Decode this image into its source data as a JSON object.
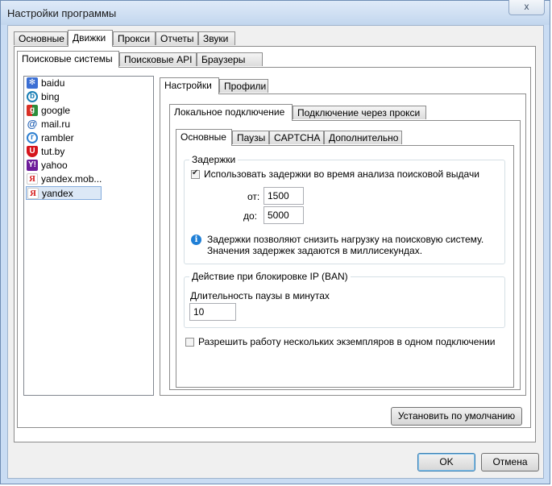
{
  "window": {
    "title": "Настройки программы",
    "close_label": "x"
  },
  "main_tabs": [
    "Основные",
    "Движки",
    "Прокси",
    "Отчеты",
    "Звуки"
  ],
  "engine_tabs": [
    "Поисковые системы",
    "Поисковые API",
    "Браузеры"
  ],
  "engines": [
    {
      "label": "baidu",
      "icon": "baidu-icon"
    },
    {
      "label": "bing",
      "icon": "bing-icon"
    },
    {
      "label": "google",
      "icon": "google-icon"
    },
    {
      "label": "mail.ru",
      "icon": "mailru-icon"
    },
    {
      "label": "rambler",
      "icon": "rambler-icon"
    },
    {
      "label": "tut.by",
      "icon": "tutby-icon"
    },
    {
      "label": "yahoo",
      "icon": "yahoo-icon"
    },
    {
      "label": "yandex.mob...",
      "icon": "yandex-icon"
    },
    {
      "label": "yandex",
      "icon": "yandex-icon",
      "selected": true
    }
  ],
  "settings_tabs": [
    "Настройки",
    "Профили"
  ],
  "connection_tabs": [
    "Локальное подключение",
    "Подключение через прокси"
  ],
  "inner_tabs": [
    "Основные",
    "Паузы",
    "CAPTCHA",
    "Дополнительно"
  ],
  "delays": {
    "title": "Задержки",
    "use_label": "Использовать задержки во время анализа поисковой выдачи",
    "from_label": "от:",
    "from_value": "1500",
    "to_label": "до:",
    "to_value": "5000",
    "info_line1": "Задержки позволяют снизить нагрузку на поисковую систему.",
    "info_line2": "Значения задержек задаются в миллисекундах."
  },
  "ban": {
    "title": "Действие при блокировке IP (BAN)",
    "pause_label": "Длительность паузы в минутах",
    "pause_value": "10"
  },
  "multi_label": "Разрешить работу нескольких экземпляров в одном подключении",
  "buttons": {
    "defaults": "Установить по умолчанию",
    "ok": "OK",
    "cancel": "Отмена"
  }
}
